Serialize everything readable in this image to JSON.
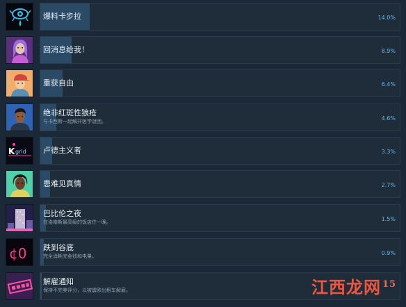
{
  "achievements": [
    {
      "title": "爆料卡步拉",
      "description": "",
      "percent_label": "14.0%",
      "percent": 14.0,
      "icon": "blue-eye-icon"
    },
    {
      "title": "回消息给我！",
      "description": "",
      "percent_label": "8.9%",
      "percent": 8.9,
      "icon": "purple-hair-portrait-icon"
    },
    {
      "title": "重获自由",
      "description": "",
      "percent_label": "6.4%",
      "percent": 6.4,
      "icon": "cap-portrait-icon"
    },
    {
      "title": "绝非红斑性狼疮",
      "description": "与卡西斯一起解开医学谜团。",
      "percent_label": "4.6%",
      "percent": 4.6,
      "icon": "man-portrait-icon"
    },
    {
      "title": "卢德主义者",
      "description": "",
      "percent_label": "3.3%",
      "percent": 3.3,
      "icon": "kilgrid-logo-icon"
    },
    {
      "title": "患难见真情",
      "description": "",
      "percent_label": "2.7%",
      "percent": 2.7,
      "icon": "dreadlocks-portrait-icon"
    },
    {
      "title": "巴比伦之夜",
      "description": "在洛南斯最高级的饭店住一晚。",
      "percent_label": "1.5%",
      "percent": 1.5,
      "icon": "night-tower-icon"
    },
    {
      "title": "跌到谷底",
      "description": "完全消耗完金钱和电量。",
      "percent_label": "0.9%",
      "percent": 0.9,
      "icon": "zero-cents-icon"
    },
    {
      "title": "解雇通知",
      "description": "保持不完美评分，以被震欧出租车解雇。",
      "percent_label": "",
      "percent": 0.4,
      "icon": "fired-stamp-icon"
    }
  ],
  "watermark": {
    "text": "江西龙网",
    "suffix": "15"
  },
  "colors": {
    "background": "#1b2838",
    "card": "#1f2d3a",
    "fill": "#2a4a66",
    "percent": "#6fb6e8"
  }
}
